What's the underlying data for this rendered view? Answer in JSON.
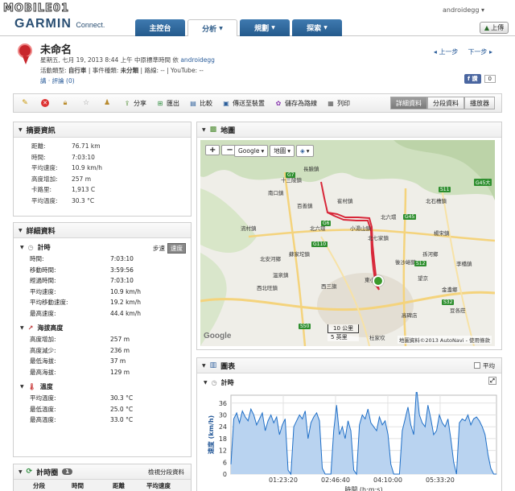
{
  "header": {
    "site_logo": "MOBILE01",
    "brand": "GARMIN",
    "brand_sub": "Connect.",
    "username": "androidegg",
    "upload_label": "上傳",
    "tabs": [
      {
        "label": "主控台",
        "has_caret": false
      },
      {
        "label": "分析",
        "has_caret": true
      },
      {
        "label": "規劃",
        "has_caret": true
      },
      {
        "label": "探索",
        "has_caret": true
      }
    ]
  },
  "activity": {
    "title": "未命名",
    "meta_line1": "星期五, 七月 19, 2013 8:44 上午 中原標準時間 依",
    "owner": "androidegg",
    "meta_line2_a": "活動類型:",
    "type": "自行車",
    "meta_line2_b": "| 事件種類:",
    "event": "未分類",
    "meta_line2_c": "| 路線: -- | YouTube: --",
    "comment_link": "講",
    "comment_count": "· 評論 (0)",
    "prev": "上一步",
    "next": "下一步",
    "fb_label": "讚",
    "fb_count": "0"
  },
  "toolbar": {
    "items": [
      "分享",
      "匯出",
      "比較",
      "傳送至裝置",
      "儲存為路線",
      "列印"
    ],
    "views": [
      "詳細資料",
      "分段資料",
      "播放器"
    ]
  },
  "summary": {
    "title": "摘要資訊",
    "rows": [
      {
        "k": "距離:",
        "v": "76.71 km"
      },
      {
        "k": "時間:",
        "v": "7:03:10"
      },
      {
        "k": "平均速度:",
        "v": "10.9 km/h"
      },
      {
        "k": "高度增加:",
        "v": "257 m"
      },
      {
        "k": "卡路里:",
        "v": "1,913 C"
      },
      {
        "k": "平均溫度:",
        "v": "30.3 °C"
      }
    ]
  },
  "details": {
    "title": "詳細資料",
    "timing": {
      "title": "計時",
      "toggle_a": "步速",
      "toggle_b": "速度",
      "rows": [
        {
          "k": "時間:",
          "v": "7:03:10"
        },
        {
          "k": "移動時間:",
          "v": "3:59:56"
        },
        {
          "k": "經過時間:",
          "v": "7:03:10"
        },
        {
          "k": "平均速度:",
          "v": "10.9 km/h"
        },
        {
          "k": "平均移動速度:",
          "v": "19.2 km/h"
        },
        {
          "k": "最高速度:",
          "v": "44.4 km/h"
        }
      ]
    },
    "elevation": {
      "title": "海拔高度",
      "rows": [
        {
          "k": "高度增加:",
          "v": "257 m"
        },
        {
          "k": "高度減少:",
          "v": "236 m"
        },
        {
          "k": "最低海拔:",
          "v": "37 m"
        },
        {
          "k": "最高海拔:",
          "v": "129 m"
        }
      ]
    },
    "temperature": {
      "title": "溫度",
      "rows": [
        {
          "k": "平均溫度:",
          "v": "30.3 °C"
        },
        {
          "k": "最低溫度:",
          "v": "25.0 °C"
        },
        {
          "k": "最高溫度:",
          "v": "33.0 °C"
        }
      ]
    }
  },
  "laps": {
    "title": "計時圈",
    "count": "1",
    "link": "檢視分段資料",
    "columns": [
      "分段",
      "時間",
      "距離",
      "平均速度"
    ]
  },
  "map": {
    "title": "地圖",
    "provider": "Google",
    "type": "地圖",
    "scale_km": "10 公里",
    "scale_mi": "5 英里",
    "attribution": "地圖資料©2013 AutoNavi - 使用條款",
    "google_mark": "Google",
    "labels": [
      {
        "t": "長臉鎮"
      },
      {
        "t": "十三陵鎮"
      },
      {
        "t": "崔村鎮"
      },
      {
        "t": "南口鎮"
      },
      {
        "t": "百善鎮"
      },
      {
        "t": "北六環"
      },
      {
        "t": "流村鎮"
      },
      {
        "t": "小湯山鎮"
      },
      {
        "t": "北七家鎮"
      },
      {
        "t": "北京"
      },
      {
        "t": "望京"
      },
      {
        "t": "後沙峪鎮"
      },
      {
        "t": "北六環"
      },
      {
        "t": "北石槽鎮"
      },
      {
        "t": "楊宋鎮"
      },
      {
        "t": "蘇家坨鎮"
      },
      {
        "t": "北安河鄉"
      },
      {
        "t": "溫泉鎮"
      },
      {
        "t": "西北旺鎮"
      },
      {
        "t": "東小口"
      },
      {
        "t": "西三旗"
      },
      {
        "t": "孫河鄉"
      },
      {
        "t": "李橋鎮"
      },
      {
        "t": "金盞鄉"
      },
      {
        "t": "豆各莊"
      },
      {
        "t": "高碑店"
      },
      {
        "t": "杜家坎"
      }
    ],
    "road_labels": [
      "G7",
      "G6",
      "S11",
      "G45",
      "G110",
      "S12",
      "S32",
      "S50",
      "G45大"
    ]
  },
  "chart": {
    "title": "圖表",
    "avg_label": "平均",
    "sub_title": "計時",
    "x_axis_label": "時間 (h:m:s)"
  },
  "chart_data": {
    "type": "area",
    "ylabel": "速度 (km/h)",
    "xlabel": "時間 (h:m:s)",
    "ylim": [
      0,
      40
    ],
    "y_ticks": [
      0,
      6,
      12,
      18,
      24,
      30,
      36
    ],
    "x_tick_labels": [
      "01:23:20",
      "02:46:40",
      "04:10:00",
      "05:33:20"
    ],
    "series": [
      {
        "values": [
          5,
          28,
          31,
          26,
          32,
          29,
          27,
          33,
          30,
          25,
          28,
          31,
          22,
          27,
          30,
          26,
          29,
          20,
          25,
          28,
          2,
          0,
          24,
          27,
          30,
          28,
          32,
          18,
          26,
          29,
          31,
          27,
          3,
          0,
          0,
          0,
          22,
          35,
          20,
          24,
          18,
          27,
          22,
          2,
          0,
          25,
          30,
          28,
          33,
          26,
          24,
          22,
          29,
          25,
          27,
          20,
          5,
          0,
          0,
          0,
          22,
          28,
          34,
          25,
          20,
          44,
          30,
          26,
          24,
          35,
          28,
          20,
          22,
          30,
          26,
          24,
          28,
          18,
          6,
          0,
          26,
          28,
          27,
          30,
          25,
          28,
          29,
          27,
          24,
          20,
          10,
          3,
          0,
          0
        ]
      }
    ],
    "x_range": [
      0,
      25390
    ]
  }
}
